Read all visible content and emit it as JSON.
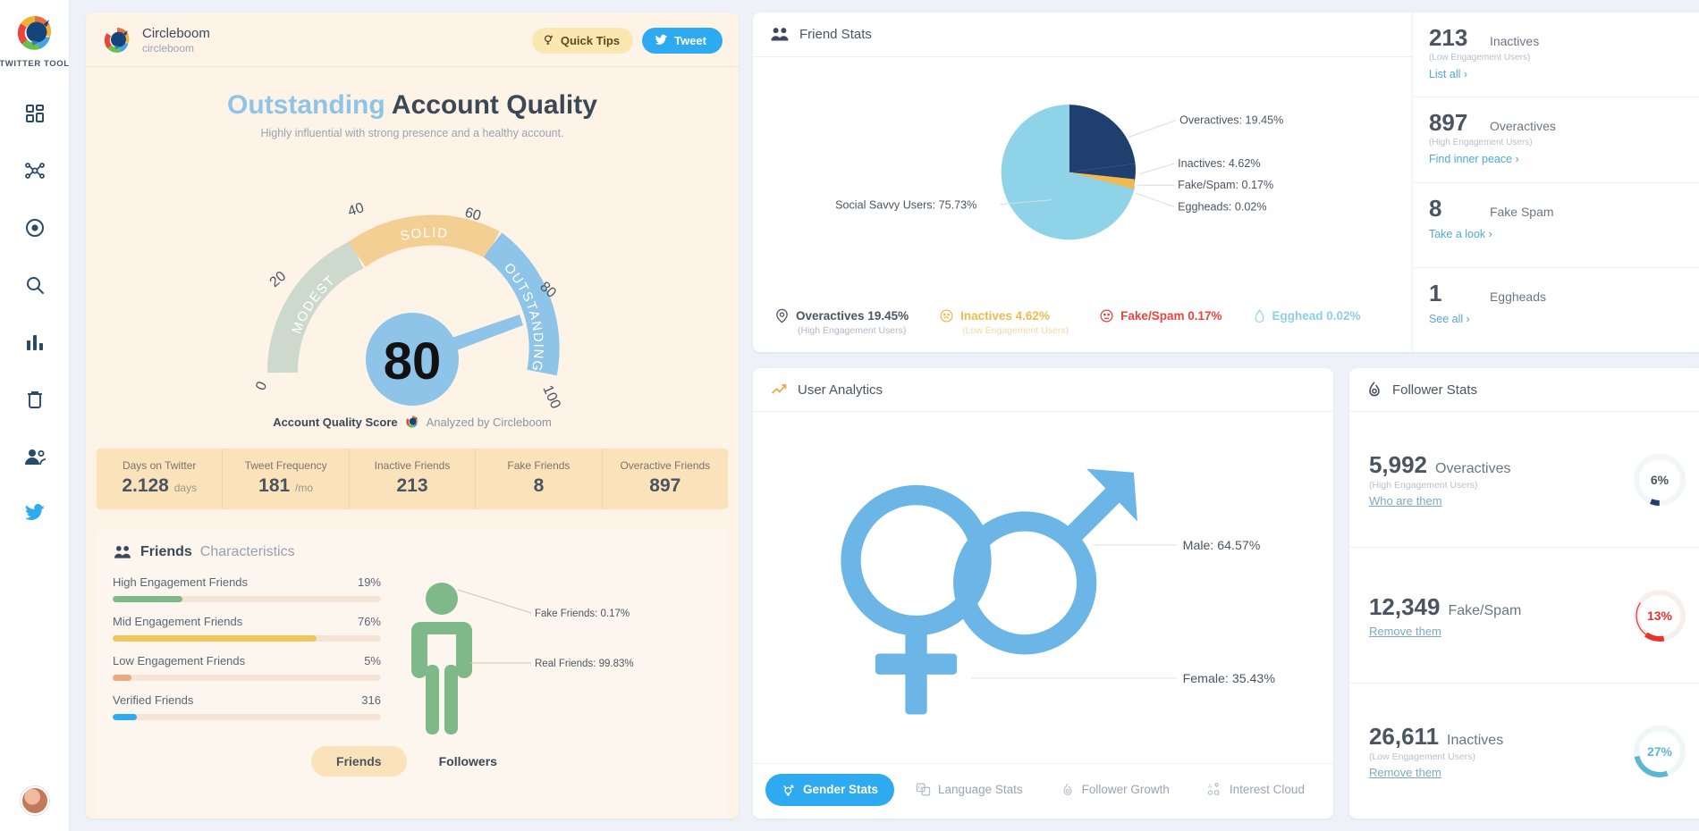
{
  "sidebar": {
    "brand_label": "TWITTER TOOL",
    "items": [
      {
        "icon": "dashboard-icon",
        "name": "dashboard"
      },
      {
        "icon": "network-icon",
        "name": "network"
      },
      {
        "icon": "target-icon",
        "name": "target"
      },
      {
        "icon": "search-icon",
        "name": "search"
      },
      {
        "icon": "bar-chart-icon",
        "name": "analytics"
      },
      {
        "icon": "trash-icon",
        "name": "cleanup"
      },
      {
        "icon": "users-icon",
        "name": "users"
      },
      {
        "icon": "twitter-icon",
        "name": "twitter"
      }
    ]
  },
  "quality": {
    "account_name": "Circleboom",
    "account_handle": "circleboom",
    "quick_tips_label": "Quick Tips",
    "tweet_label": "Tweet",
    "title_accent": "Outstanding",
    "title_rest": "Account Quality",
    "subtitle": "Highly influential with strong presence and a healthy account.",
    "score": "80",
    "score_caption": "Account Quality Score",
    "analyzed_by": "Analyzed by Circleboom",
    "gauge": {
      "ticks": [
        "0",
        "20",
        "40",
        "60",
        "80",
        "100"
      ],
      "bands": [
        {
          "label": "MODEST",
          "from": 0,
          "to": 40,
          "color": "#cdd9cc"
        },
        {
          "label": "SOLID",
          "from": 40,
          "to": 70,
          "color": "#f3cf94"
        },
        {
          "label": "OUTSTANDING",
          "from": 70,
          "to": 100,
          "color": "#8ec4e8"
        }
      ],
      "needle_value": 80
    },
    "stats": [
      {
        "title": "Days on Twitter",
        "value": "2.128",
        "unit": "days"
      },
      {
        "title": "Tweet Frequency",
        "value": "181",
        "unit": "/mo"
      },
      {
        "title": "Inactive Friends",
        "value": "213",
        "unit": ""
      },
      {
        "title": "Fake Friends",
        "value": "8",
        "unit": ""
      },
      {
        "title": "Overactive Friends",
        "value": "897",
        "unit": ""
      }
    ],
    "characteristics": {
      "title_bold": "Friends",
      "title_light": "Characteristics",
      "bars": [
        {
          "label": "High Engagement Friends",
          "value": "19%",
          "pct": 19,
          "color": "#7fb98a"
        },
        {
          "label": "Mid Engagement Friends",
          "value": "76%",
          "pct": 76,
          "color": "#f2c45c"
        },
        {
          "label": "Low Engagement Friends",
          "value": "5%",
          "pct": 5,
          "color": "#eca87e"
        },
        {
          "label": "Verified Friends",
          "value": "316",
          "pct": 7,
          "color": "#2eaaf0"
        }
      ],
      "person_labels": [
        {
          "text": "Fake Friends: 0.17%"
        },
        {
          "text": "Real Friends: 99.83%"
        }
      ]
    },
    "toggle": {
      "active": "Friends",
      "inactive": "Followers"
    }
  },
  "friend_stats": {
    "title": "Friend Stats",
    "labels": {
      "social_savvy": "Social Savvy Users: 75.73%",
      "overactives": "Overactives: 19.45%",
      "inactives": "Inactives: 4.62%",
      "fake_spam": "Fake/Spam: 0.17%",
      "eggheads": "Eggheads: 0.02%"
    },
    "legend": [
      {
        "label": "Overactives 19.45%",
        "sub": "(High Engagement Users)",
        "color": "#4a5561",
        "icon": "overactive-icon"
      },
      {
        "label": "Inactives 4.62%",
        "sub": "(Low Engagement Users)",
        "color": "#f0b952",
        "icon": "sad-face-icon"
      },
      {
        "label": "Fake/Spam 0.17%",
        "sub": "",
        "color": "#e8453c",
        "icon": "spam-face-icon"
      },
      {
        "label": "Egghead 0.02%",
        "sub": "",
        "color": "#8ecfe8",
        "icon": "egg-icon"
      }
    ],
    "breakdown": [
      {
        "num": "213",
        "name": "Inactives",
        "sub": "(Low Engagement Users)",
        "link": "List all"
      },
      {
        "num": "897",
        "name": "Overactives",
        "sub": "(High Engagement Users)",
        "link": "Find inner peace"
      },
      {
        "num": "8",
        "name": "Fake Spam",
        "sub": "",
        "link": "Take a look"
      },
      {
        "num": "1",
        "name": "Eggheads",
        "sub": "",
        "link": "See all"
      }
    ]
  },
  "user_analytics": {
    "title": "User Analytics",
    "male_label": "Male: 64.57%",
    "female_label": "Female: 35.43%",
    "tabs": [
      {
        "label": "Gender Stats",
        "icon": "gender-icon",
        "active": true
      },
      {
        "label": "Language Stats",
        "icon": "translate-icon",
        "active": false
      },
      {
        "label": "Follower Growth",
        "icon": "flame-icon",
        "active": false
      },
      {
        "label": "Interest Cloud",
        "icon": "cloud-icon",
        "active": false
      }
    ]
  },
  "follower_stats": {
    "title": "Follower Stats",
    "items": [
      {
        "num": "5,992",
        "name": "Overactives",
        "sub": "(High Engagement Users)",
        "link": "Who are them",
        "pct": "6%",
        "pct_value": 6,
        "color": "#1f3f6e"
      },
      {
        "num": "12,349",
        "name": "Fake/Spam",
        "sub": "",
        "link": "Remove them",
        "pct": "13%",
        "pct_value": 13,
        "color": "#e8332a"
      },
      {
        "num": "26,611",
        "name": "Inactives",
        "sub": "(Low Engagement Users)",
        "link": "Remove them",
        "pct": "27%",
        "pct_value": 27,
        "color": "#5cb8cf"
      }
    ]
  },
  "chart_data": [
    {
      "type": "pie",
      "title": "Friend Stats",
      "categories": [
        "Social Savvy Users",
        "Overactives",
        "Inactives",
        "Fake/Spam",
        "Eggheads"
      ],
      "values": [
        75.73,
        19.45,
        4.62,
        0.17,
        0.02
      ],
      "colors": [
        "#8ed3e8",
        "#1f3f6e",
        "#f0b952",
        "#e8453c",
        "#cfe9f2"
      ],
      "unit": "%",
      "legend": "right"
    },
    {
      "type": "pie",
      "title": "Gender Stats",
      "categories": [
        "Male",
        "Female"
      ],
      "values": [
        64.57,
        35.43
      ],
      "colors": [
        "#5aaee0",
        "#6fb7e6"
      ],
      "unit": "%",
      "legend": "right"
    },
    {
      "type": "bar",
      "title": "Friends Characteristics",
      "categories": [
        "High Engagement Friends",
        "Mid Engagement Friends",
        "Low Engagement Friends",
        "Verified Friends"
      ],
      "values": [
        19,
        76,
        5,
        316
      ],
      "value_labels": [
        "19%",
        "76%",
        "5%",
        "316"
      ],
      "colors": [
        "#7fb98a",
        "#f2c45c",
        "#eca87e",
        "#2eaaf0"
      ],
      "xlabel": "",
      "ylabel": "",
      "ylim": [
        0,
        100
      ],
      "grid": false
    },
    {
      "type": "gauge",
      "title": "Account Quality Score",
      "value": 80,
      "ylim": [
        0,
        100
      ],
      "ticks": [
        0,
        20,
        40,
        60,
        80,
        100
      ],
      "bands": [
        {
          "label": "MODEST",
          "range": [
            0,
            40
          ],
          "color": "#cdd9cc"
        },
        {
          "label": "SOLID",
          "range": [
            40,
            70
          ],
          "color": "#f3cf94"
        },
        {
          "label": "OUTSTANDING",
          "range": [
            70,
            100
          ],
          "color": "#8ec4e8"
        }
      ]
    }
  ]
}
